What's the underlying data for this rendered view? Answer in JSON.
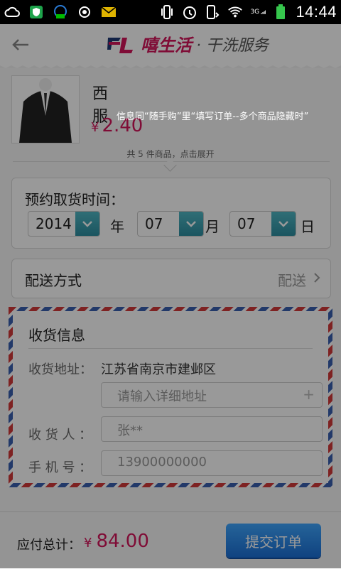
{
  "status_bar": {
    "time": "14:44",
    "network": "3G",
    "left_icons": [
      "cloud-icon",
      "shield-app-icon",
      "chat-bubble-icon",
      "camera-icon",
      "mail-icon"
    ],
    "right_icons": [
      "vibrate-icon",
      "alarm-icon",
      "rotation-icon",
      "wifi-icon",
      "signal-icon",
      "battery-icon"
    ]
  },
  "header": {
    "logo_text": "嘻生活",
    "logo_sub": "· 干洗服务"
  },
  "product": {
    "name": "西服",
    "currency": "¥",
    "price": "2.40"
  },
  "summary_text": "共 5 件商品，点击展开",
  "pickup": {
    "title": "预约取货时间：",
    "year": "2014",
    "year_unit": "年",
    "month": "07",
    "month_unit": "月",
    "day": "07",
    "day_unit": "日"
  },
  "shipping": {
    "label": "配送方式",
    "value": "配送"
  },
  "address": {
    "title": "收货信息",
    "addr_label": "收货地址：",
    "addr_value": "江苏省南京市建邺区",
    "detail_placeholder": "请输入详细地址",
    "receiver_label": "收 货 人 ：",
    "receiver_value": "张**",
    "phone_label": "手 机 号 ：",
    "phone_value": "13900000000"
  },
  "footer": {
    "total_label": "应付总计：",
    "currency": "¥",
    "total_value": "84.00",
    "submit_label": "提交订单"
  },
  "overlay_note": "信息同“随手购”里“填写订单--多个商品隐藏时”",
  "colors": {
    "accent": "#d4145a",
    "teal": "#2e8ea0",
    "submit_blue": "#1a6fd6"
  }
}
